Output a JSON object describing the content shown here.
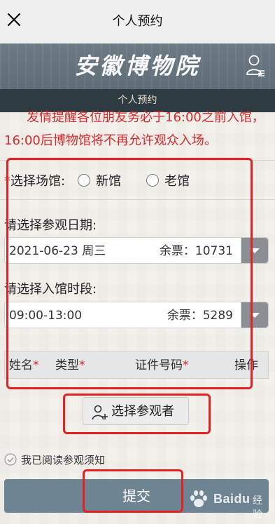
{
  "window": {
    "title": "个人预约",
    "close_icon": "close-icon"
  },
  "banner": {
    "logo_text": "安徽博物院",
    "user_icon": "user-list-icon",
    "colors": {
      "banner": "#64717A",
      "subnav": "#2F3B43",
      "accent_red": "#D12B2B"
    }
  },
  "subnav": {
    "label": "个人预约"
  },
  "notice": {
    "line1": "发情提醒各位朋友务必于16:00之前入馆，",
    "line2": "16:00后博物馆将不再允许观众入场。"
  },
  "venue": {
    "label": "选择场馆:",
    "options": [
      "新馆",
      "老馆"
    ],
    "required_mark": "*"
  },
  "date": {
    "label": "请选择参观日期:",
    "selected": "2021-06-23 周三",
    "tickets_label": "余票：",
    "tickets_value": "10731"
  },
  "timeslot": {
    "label": "请选择入馆时段:",
    "selected": "09:00-13:00",
    "tickets_label": "余票：",
    "tickets_value": "5289"
  },
  "table": {
    "headers": [
      "姓名",
      "类型",
      "证件号码",
      "操作"
    ],
    "required_mark": "*"
  },
  "select_visitor": {
    "label": "选择参观者",
    "icon": "add-user-icon"
  },
  "agreement": {
    "label": "我已阅读参观须知",
    "icon": "check-circle-icon"
  },
  "submit": {
    "label": "提交"
  },
  "watermark": {
    "brand": "Bai",
    "paw": "du",
    "suffix": "经验"
  }
}
